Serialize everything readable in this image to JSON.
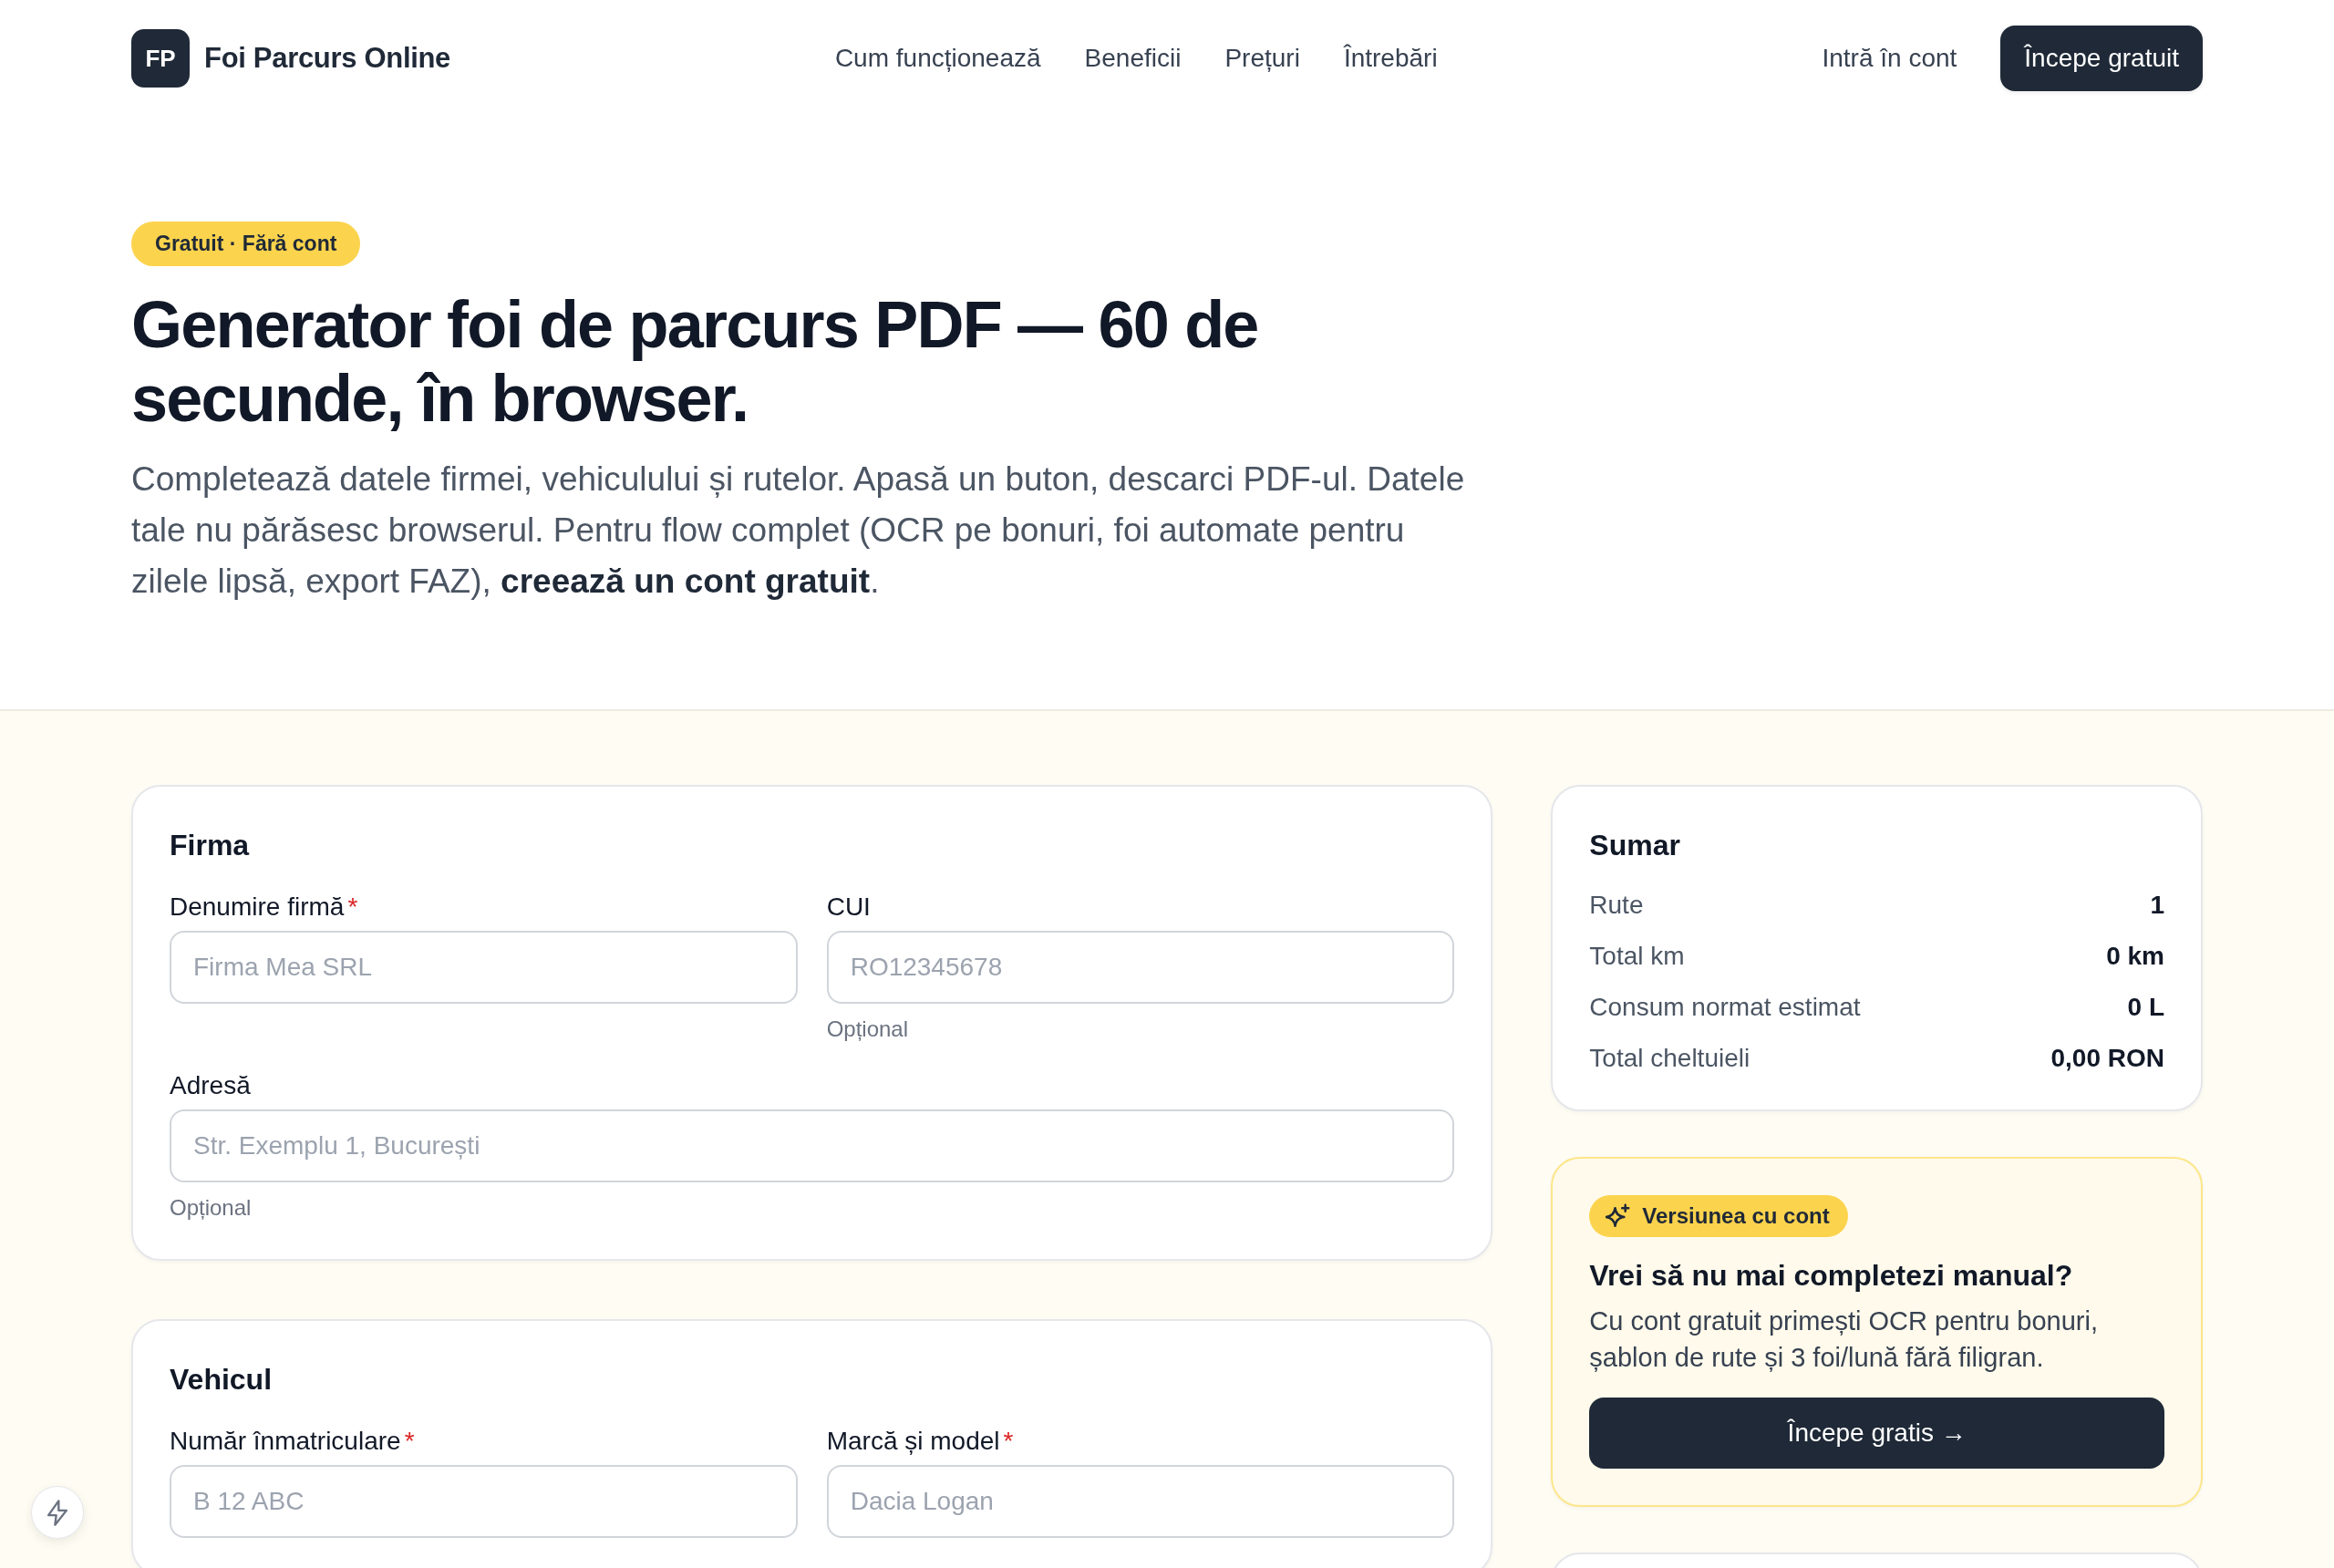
{
  "header": {
    "logo_mark": "FP",
    "brand": "Foi Parcurs Online",
    "nav": [
      {
        "label": "Cum funcționează"
      },
      {
        "label": "Beneficii"
      },
      {
        "label": "Prețuri"
      },
      {
        "label": "Întrebări"
      }
    ],
    "login_link": "Intră în cont",
    "cta_button": "Începe gratuit"
  },
  "hero": {
    "badge": "Gratuit · Fără cont",
    "title": "Generator foi de parcurs PDF — 60 de secunde, în browser.",
    "description": "Completează datele firmei, vehiculului și rutelor. Apasă un buton, descarci PDF-ul. Datele tale nu părăsesc browserul. Pentru flow complet (OCR pe bonuri, foi automate pentru zilele lipsă, export FAZ), **creează un cont gratuit**."
  },
  "form_sections": [
    {
      "title": "Firma",
      "rows": [
        [
          {
            "label": "Denumire firmă",
            "required_mark": "*",
            "placeholder": "Firma Mea SRL"
          },
          {
            "label": "CUI",
            "placeholder": "RO12345678",
            "hint": "Opțional"
          }
        ],
        [
          {
            "label": "Adresă",
            "placeholder": "Str. Exemplu 1, București",
            "hint": "Opțional"
          }
        ]
      ]
    },
    {
      "title": "Vehicul",
      "rows": [
        [
          {
            "label": "Număr înmatriculare",
            "required_mark": "*",
            "placeholder": "B 12 ABC"
          },
          {
            "label": "Marcă și model",
            "required_mark": "*",
            "placeholder": "Dacia Logan"
          }
        ]
      ]
    }
  ],
  "summary": {
    "title": "Sumar",
    "rows": [
      {
        "label": "Rute",
        "value": "1"
      },
      {
        "label": "Total km",
        "value": "0 km"
      },
      {
        "label": "Consum normat estimat",
        "value": "0 L"
      },
      {
        "label": "Total cheltuieli",
        "value": "0,00 RON"
      }
    ]
  },
  "promo": {
    "badge": "Versiunea cu cont",
    "title": "Vrei să nu mai completezi manual?",
    "text": "Cu cont gratuit primești OCR pentru bonuri, șablon de rute și 3 foi/lună fără filigran.",
    "button": "Începe gratis →"
  }
}
